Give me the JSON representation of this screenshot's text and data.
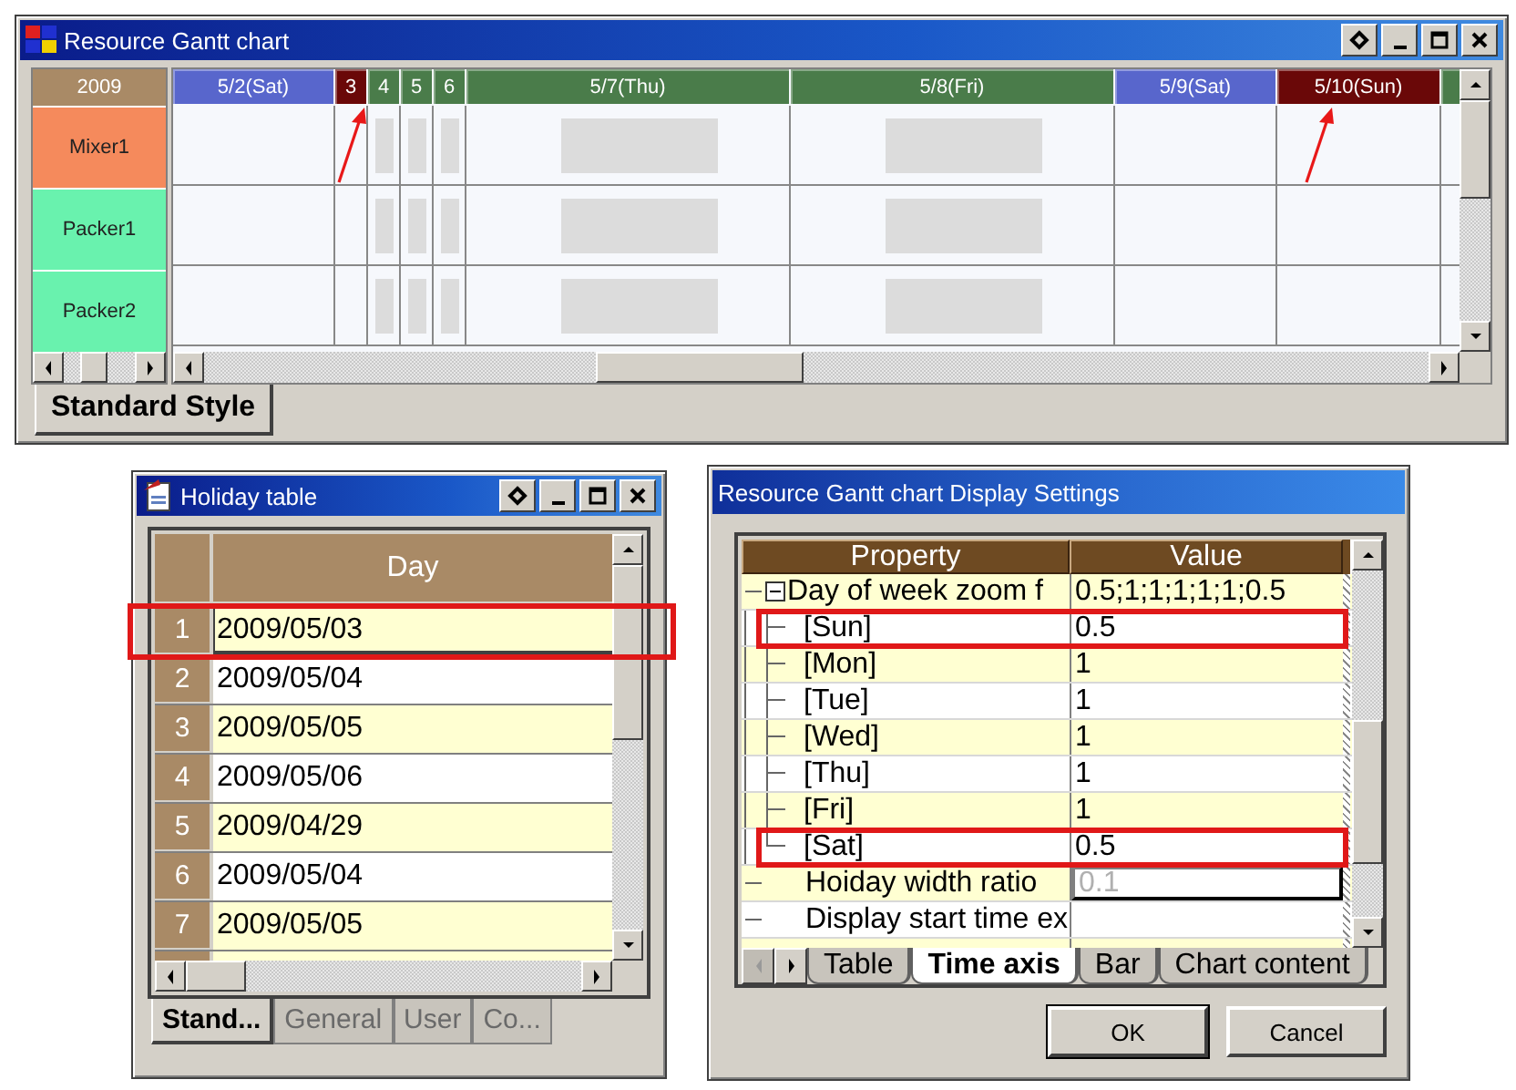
{
  "gantt_window": {
    "title": "Resource Gantt chart",
    "year": "2009",
    "resources": [
      {
        "name": "Mixer1",
        "color": "#f58a5c"
      },
      {
        "name": "Packer1",
        "color": "#69f2ae"
      },
      {
        "name": "Packer2",
        "color": "#69f2ae"
      }
    ],
    "days": [
      {
        "label": "5/2(Sat)",
        "kind": "saturday",
        "pointed": false
      },
      {
        "label": "3",
        "kind": "sundayoff",
        "pointed": true
      },
      {
        "label": "4",
        "kind": "holiday",
        "pointed": false
      },
      {
        "label": "5",
        "kind": "holiday",
        "pointed": false
      },
      {
        "label": "6",
        "kind": "holiday",
        "pointed": false
      },
      {
        "label": "5/7(Thu)",
        "kind": "weekday",
        "pointed": false
      },
      {
        "label": "5/8(Fri)",
        "kind": "weekday",
        "pointed": false
      },
      {
        "label": "5/9(Sat)",
        "kind": "saturday",
        "pointed": false
      },
      {
        "label": "5/10(Sun)",
        "kind": "sunday",
        "pointed": true
      },
      {
        "kind": "weekday"
      }
    ],
    "tabs": [
      {
        "label": "Standard Style",
        "selected": true
      }
    ]
  },
  "holiday_window": {
    "title": "Holiday table",
    "column": "Day",
    "rows": [
      {
        "number": "1",
        "day": "2009/05/03",
        "selected": true,
        "highlighted": true
      },
      {
        "number": "2",
        "day": "2009/05/04",
        "selected": false,
        "highlighted": false
      },
      {
        "number": "3",
        "day": "2009/05/05",
        "selected": false,
        "highlighted": false
      },
      {
        "number": "4",
        "day": "2009/05/06",
        "selected": false,
        "highlighted": false
      },
      {
        "number": "5",
        "day": "2009/04/29",
        "selected": false,
        "highlighted": false
      },
      {
        "number": "6",
        "day": "2009/05/04",
        "selected": false,
        "highlighted": false
      },
      {
        "number": "7",
        "day": "2009/05/05",
        "selected": false,
        "highlighted": false
      }
    ],
    "tabs": [
      {
        "label": "Stand...",
        "selected": true
      },
      {
        "label": "General",
        "selected": false
      },
      {
        "label": "User",
        "selected": false
      },
      {
        "label": "Co...",
        "selected": false
      }
    ]
  },
  "settings_dialog": {
    "title": "Resource Gantt chart Display Settings",
    "columns": [
      "Property",
      "Value"
    ],
    "properties": [
      {
        "name": "Day of week zoom f",
        "value": "0.5;1;1;1;1;1;0.5",
        "expanded": true,
        "highlighted": false,
        "children": [
          {
            "name": "[Sun]",
            "value": "0.5",
            "highlighted": true
          },
          {
            "name": "[Mon]",
            "value": "1",
            "highlighted": false
          },
          {
            "name": "[Tue]",
            "value": "1",
            "highlighted": false
          },
          {
            "name": "[Wed]",
            "value": "1",
            "highlighted": false
          },
          {
            "name": "[Thu]",
            "value": "1",
            "highlighted": false
          },
          {
            "name": "[Fri]",
            "value": "1",
            "highlighted": false
          },
          {
            "name": "[Sat]",
            "value": "0.5",
            "highlighted": true
          }
        ]
      },
      {
        "name": "Hoiday width ratio",
        "value": "0.1",
        "editing": true,
        "highlighted": false
      },
      {
        "name": "Display start time ex",
        "highlighted": false
      }
    ],
    "tabs": [
      {
        "label": "Table",
        "selected": false
      },
      {
        "label": "Time axis",
        "selected": true
      },
      {
        "label": "Bar",
        "selected": false
      },
      {
        "label": "Chart content",
        "selected": false
      }
    ],
    "buttons": [
      "OK",
      "Cancel"
    ]
  }
}
